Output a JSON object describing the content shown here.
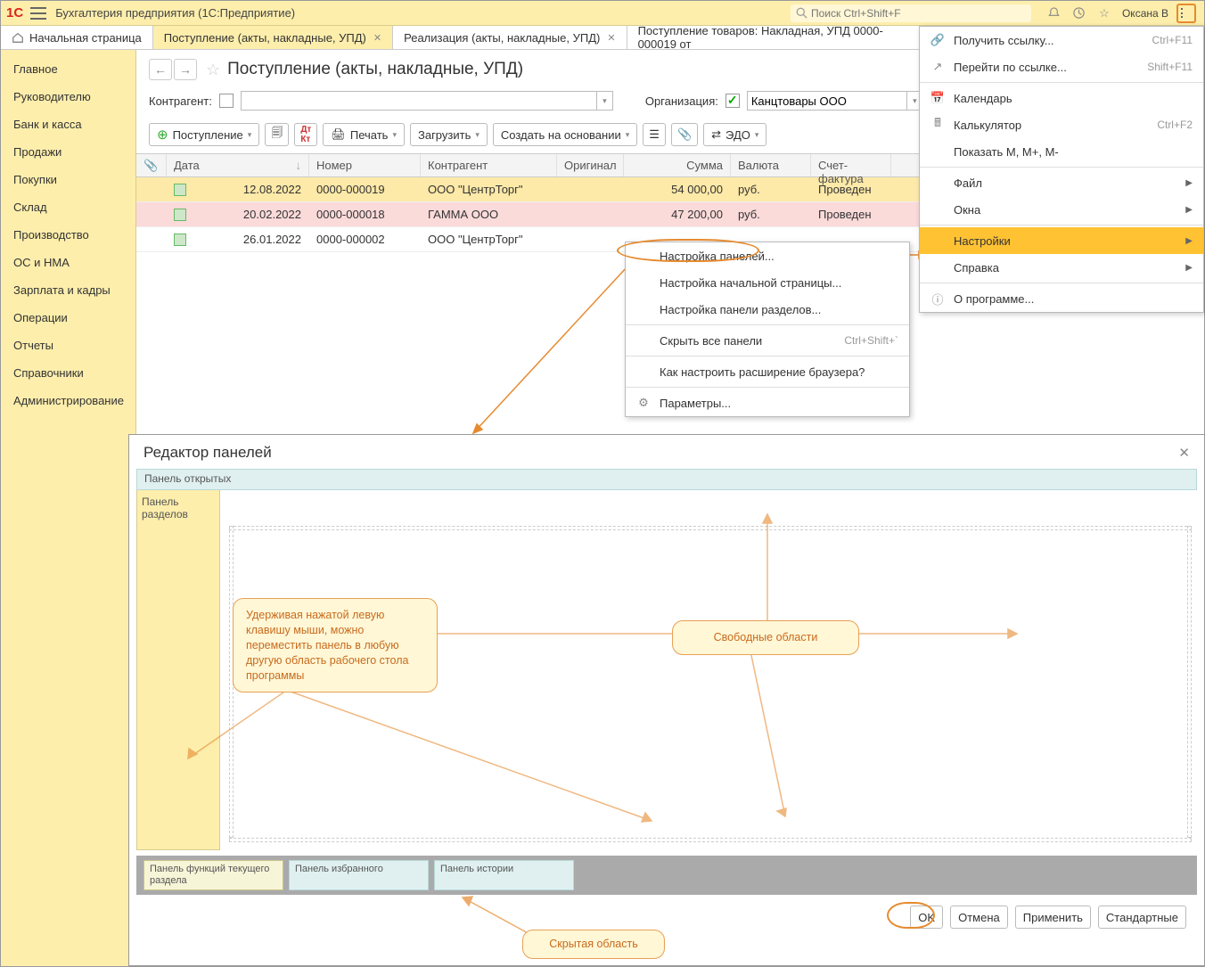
{
  "app": {
    "title": "Бухгалтерия предприятия  (1С:Предприятие)",
    "search_placeholder": "Поиск Ctrl+Shift+F",
    "username": "Оксана В"
  },
  "tabs": [
    {
      "label": "Начальная страница",
      "home": true
    },
    {
      "label": "Поступление (акты, накладные, УПД)",
      "active": true,
      "closable": true
    },
    {
      "label": "Реализация (акты, накладные, УПД)",
      "closable": true
    },
    {
      "label": "Поступление товаров: Накладная, УПД 0000-000019 от",
      "closable": true
    }
  ],
  "sidebar": [
    "Главное",
    "Руководителю",
    "Банк и касса",
    "Продажи",
    "Покупки",
    "Склад",
    "Производство",
    "ОС и НМА",
    "Зарплата и кадры",
    "Операции",
    "Отчеты",
    "Справочники",
    "Администрирование"
  ],
  "page": {
    "title": "Поступление (акты, накладные, УПД)",
    "filter": {
      "label_contr": "Контрагент:",
      "label_org": "Организация:",
      "org_value": "Канцтовары ООО"
    },
    "toolbar": {
      "receipt": "Поступление",
      "print": "Печать",
      "load": "Загрузить",
      "create_based": "Создать на основании",
      "edo": "ЭДО"
    },
    "columns": {
      "date": "Дата",
      "number": "Номер",
      "contr": "Контрагент",
      "orig": "Оригинал",
      "sum": "Сумма",
      "cur": "Валюта",
      "sf": "Счет-фактура"
    },
    "rows": [
      {
        "date": "12.08.2022",
        "num": "0000-000019",
        "contr": "ООО \"ЦентрТорг\"",
        "sum": "54 000,00",
        "cur": "руб.",
        "sf": "Проведен"
      },
      {
        "date": "20.02.2022",
        "num": "0000-000018",
        "contr": "ГАММА ООО",
        "sum": "47 200,00",
        "cur": "руб.",
        "sf": "Проведен"
      },
      {
        "date": "26.01.2022",
        "num": "0000-000002",
        "contr": "ООО \"ЦентрТорг\"",
        "sum": "",
        "cur": "",
        "sf": ""
      }
    ]
  },
  "main_menu": [
    {
      "label": "Получить ссылку...",
      "sc": "Ctrl+F11",
      "icon": "link"
    },
    {
      "label": "Перейти по ссылке...",
      "sc": "Shift+F11",
      "icon": "goto"
    },
    {
      "sep": true
    },
    {
      "label": "Календарь",
      "icon": "cal"
    },
    {
      "label": "Калькулятор",
      "sc": "Ctrl+F2",
      "icon": "calc"
    },
    {
      "label": "Показать M, M+, M-"
    },
    {
      "sep": true
    },
    {
      "label": "Файл",
      "sub": true
    },
    {
      "label": "Окна",
      "sub": true
    },
    {
      "sep": true
    },
    {
      "label": "Настройки",
      "sub": true,
      "hl": true
    },
    {
      "label": "Справка",
      "sub": true
    },
    {
      "sep": true
    },
    {
      "label": "О программе...",
      "icon": "info"
    }
  ],
  "sub_menu": [
    {
      "label": "Настройка панелей...",
      "hl": true
    },
    {
      "label": "Настройка начальной страницы..."
    },
    {
      "label": "Настройка панели разделов..."
    },
    {
      "sep": true
    },
    {
      "label": "Скрыть все панели",
      "sc": "Ctrl+Shift+`"
    },
    {
      "sep": true
    },
    {
      "label": "Как настроить расширение браузера?"
    },
    {
      "sep": true
    },
    {
      "label": "Параметры...",
      "icon": "gear"
    }
  ],
  "panel_editor": {
    "title": "Редактор панелей",
    "open_panel": "Панель открытых",
    "sections": "Панель разделов",
    "cards": [
      "Панель функций текущего раздела",
      "Панель избранного",
      "Панель истории"
    ],
    "buttons": {
      "ok": "OK",
      "cancel": "Отмена",
      "apply": "Применить",
      "defaults": "Стандартные"
    }
  },
  "callouts": {
    "drag": "Удерживая нажатой левую клавишу мыши, можно переместить панель в любую другую область рабочего стола программы",
    "free": "Свободные области",
    "hidden": "Скрытая область"
  }
}
